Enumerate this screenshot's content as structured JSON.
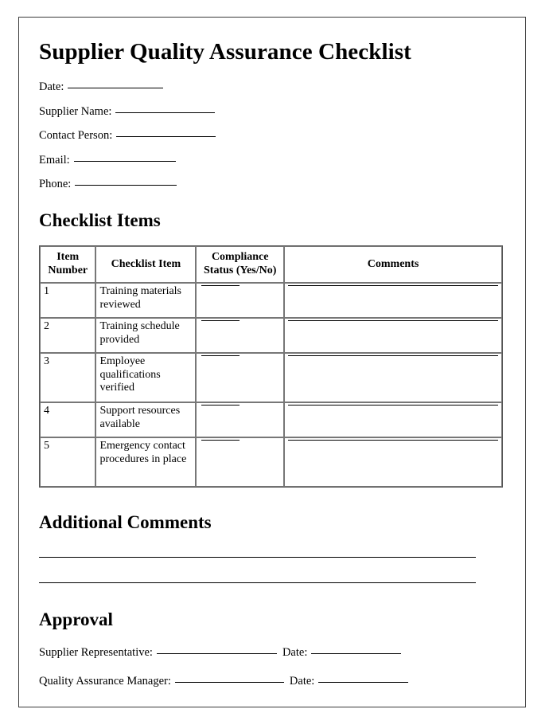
{
  "document": {
    "title": "Supplier Quality Assurance Checklist",
    "text_color": "#000000",
    "page_background": "#ffffff",
    "border_color": "#3a3a3a"
  },
  "header_fields": [
    {
      "label": "Date:",
      "value": ""
    },
    {
      "label": "Supplier Name:",
      "value": ""
    },
    {
      "label": "Contact Person:",
      "value": ""
    },
    {
      "label": "Email:",
      "value": ""
    },
    {
      "label": "Phone:",
      "value": ""
    }
  ],
  "checklist": {
    "heading": "Checklist Items",
    "columns": [
      "Item Number",
      "Checklist Item",
      "Compliance Status (Yes/No)",
      "Comments"
    ],
    "columns_lines": {
      "item_number_line1": "Item",
      "item_number_line2": "Number",
      "checklist_item": "Checklist Item",
      "compliance_line1": "Compliance",
      "compliance_line2": "Status (Yes/No)",
      "comments": "Comments"
    },
    "rows": [
      {
        "number": "1",
        "item": "Training materials reviewed",
        "status": "",
        "comments": ""
      },
      {
        "number": "2",
        "item": "Training schedule provided",
        "status": "",
        "comments": ""
      },
      {
        "number": "3",
        "item": "Employee qualifications verified",
        "status": "",
        "comments": ""
      },
      {
        "number": "4",
        "item": "Support resources available",
        "status": "",
        "comments": ""
      },
      {
        "number": "5",
        "item": "Emergency contact procedures in place",
        "status": "",
        "comments": ""
      }
    ]
  },
  "additional_comments": {
    "heading": "Additional Comments",
    "lines": [
      "",
      ""
    ]
  },
  "approval": {
    "heading": "Approval",
    "rows": [
      {
        "label": "Supplier Representative:",
        "signature": "",
        "date_label": "Date:",
        "date_value": ""
      },
      {
        "label": "Quality Assurance Manager:",
        "signature": "",
        "date_label": "Date:",
        "date_value": ""
      }
    ]
  }
}
